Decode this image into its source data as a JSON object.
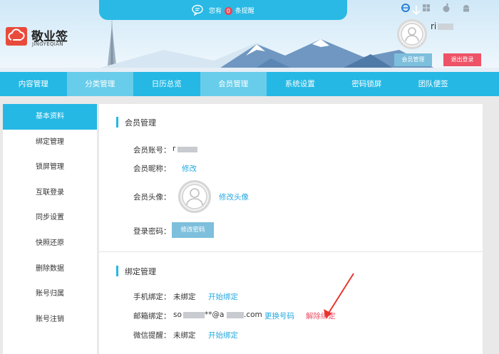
{
  "notice": {
    "prefix": "您有",
    "count": "0",
    "suffix": "条提醒"
  },
  "brand": {
    "name": "敬业签",
    "subtitle": "JINGYEQIAN"
  },
  "user": {
    "name": "ri",
    "member_button": "会员管理",
    "logout_button": "退出登录"
  },
  "os_icons": [
    "ie-icon",
    "windows-icon",
    "apple-icon",
    "android-icon"
  ],
  "topnav": {
    "items": [
      "内容管理",
      "分类管理",
      "日历总览",
      "会员管理",
      "系统设置",
      "密码锁屏",
      "团队便签"
    ],
    "active": [
      "分类管理",
      "会员管理"
    ]
  },
  "sidebar": {
    "items": [
      "基本资料",
      "绑定管理",
      "锁屏管理",
      "互联登录",
      "同步设置",
      "快照还原",
      "删除数据",
      "账号归属",
      "账号注销"
    ],
    "active": "基本资料"
  },
  "member": {
    "title": "会员管理",
    "account_label": "会员账号：",
    "account_value": "r",
    "nickname_label": "会员昵称：",
    "nickname_link": "修改",
    "avatar_label": "会员头像：",
    "avatar_link": "修改头像",
    "password_label": "登录密码：",
    "password_button": "修改密码"
  },
  "binding": {
    "title": "绑定管理",
    "phone_label": "手机绑定：",
    "phone_status": "未绑定",
    "phone_link": "开始绑定",
    "email_label": "邮箱绑定：",
    "email_prefix": "so",
    "email_mid": "**@a",
    "email_suffix": ".com",
    "email_change_link": "更换号码",
    "email_unbind_link": "解除绑定",
    "wechat_label": "微信提醒：",
    "wechat_status": "未绑定",
    "wechat_link": "开始绑定"
  },
  "colors": {
    "primary": "#26b8e4",
    "nav_active": "#68cdea",
    "button_light": "#7dbfdc",
    "danger": "#ee5266",
    "link": "#26a9e0",
    "logo": "#e84b3c",
    "annotation_arrow": "#e8352e"
  }
}
